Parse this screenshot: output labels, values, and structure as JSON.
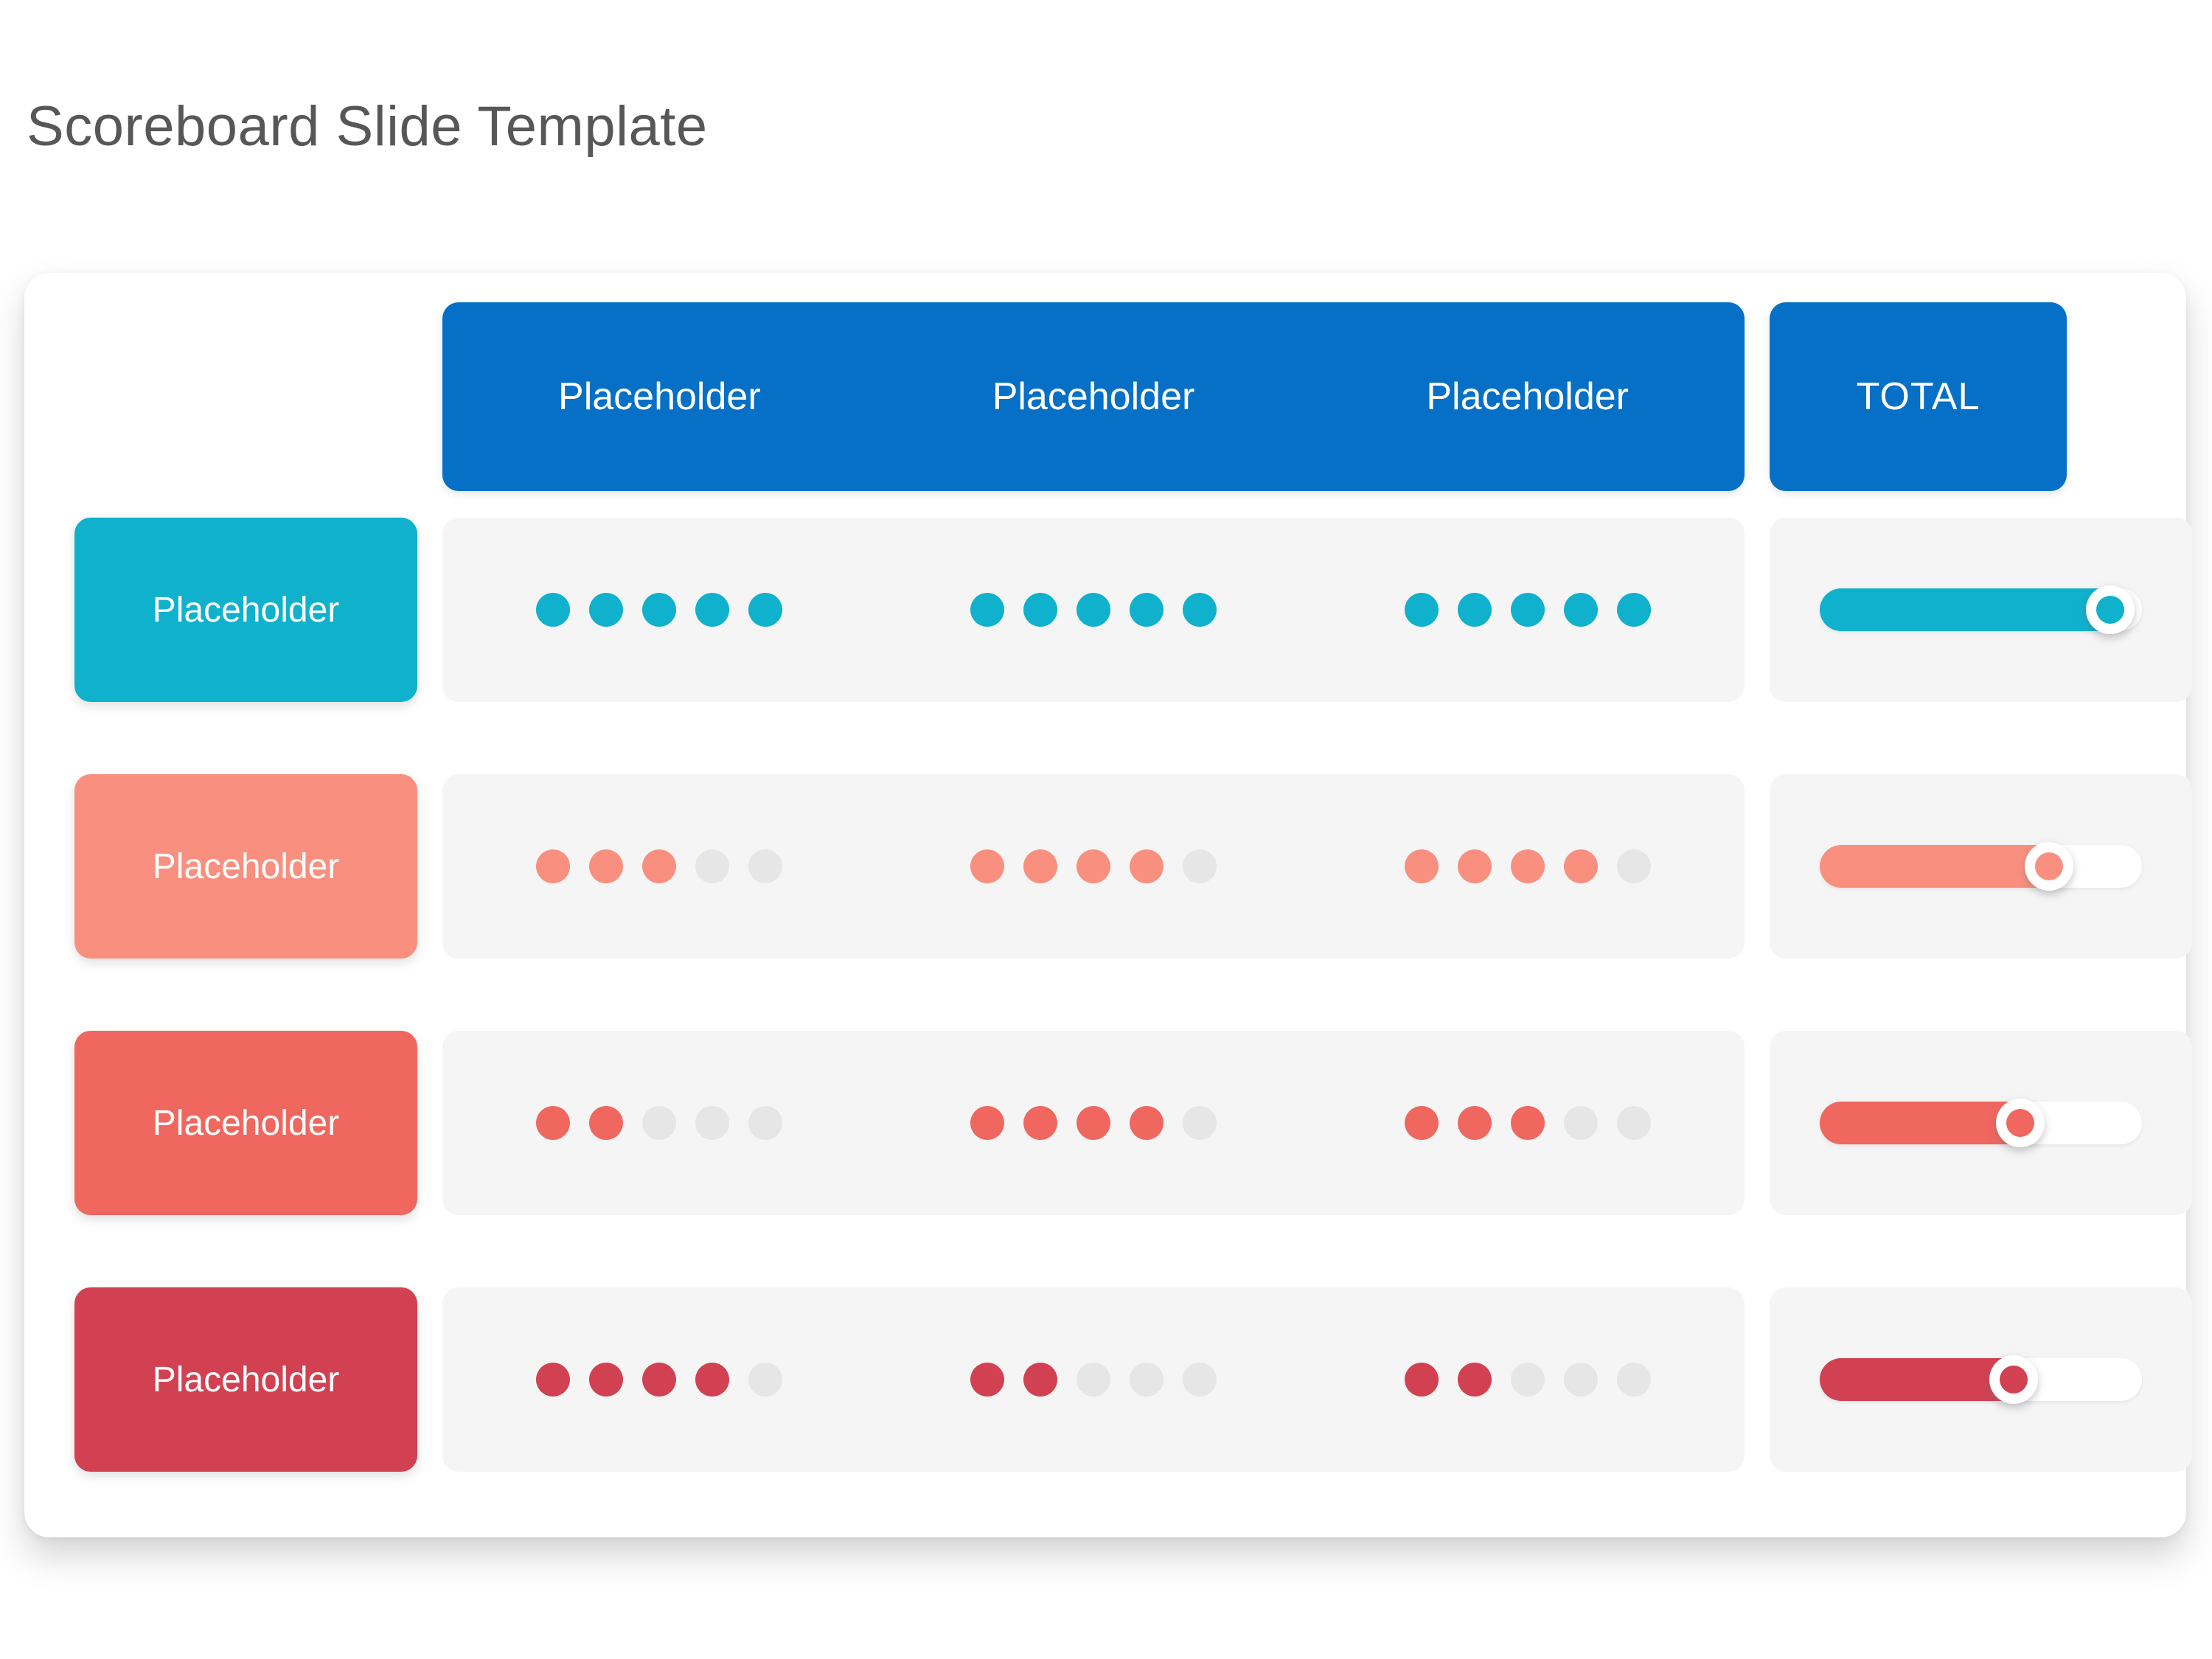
{
  "page": {
    "title": "Scoreboard Slide Template",
    "title_color": "#575757",
    "background": "#ffffff"
  },
  "theme": {
    "header_blue": "#0670c6",
    "panel_gray": "#f5f5f5",
    "empty_dot": "#e6e6e6",
    "card_white": "#ffffff"
  },
  "header": {
    "columns": [
      {
        "label": "Placeholder"
      },
      {
        "label": "Placeholder"
      },
      {
        "label": "Placeholder"
      }
    ],
    "total_label": "TOTAL"
  },
  "rows": [
    {
      "label": "Placeholder",
      "color": "#0fb1cd",
      "scores": [
        5,
        5,
        5
      ],
      "max": 5,
      "total_percent": 93
    },
    {
      "label": "Placeholder",
      "color": "#f9907f",
      "scores": [
        3,
        4,
        4
      ],
      "max": 5,
      "total_percent": 74
    },
    {
      "label": "Placeholder",
      "color": "#f0675f",
      "scores": [
        2,
        4,
        3
      ],
      "max": 5,
      "total_percent": 65
    },
    {
      "label": "Placeholder",
      "color": "#d24152",
      "scores": [
        4,
        2,
        2
      ],
      "max": 5,
      "total_percent": 63
    }
  ],
  "chart_data": {
    "type": "table",
    "title": "Scoreboard Slide Template",
    "columns": [
      "Placeholder",
      "Placeholder",
      "Placeholder",
      "TOTAL"
    ],
    "row_labels": [
      "Placeholder",
      "Placeholder",
      "Placeholder",
      "Placeholder"
    ],
    "rating_scale_max": 5,
    "series": [
      {
        "name": "Placeholder",
        "values": [
          5,
          5,
          5
        ],
        "total_percent": 93,
        "color": "#0fb1cd"
      },
      {
        "name": "Placeholder",
        "values": [
          3,
          4,
          4
        ],
        "total_percent": 74,
        "color": "#f9907f"
      },
      {
        "name": "Placeholder",
        "values": [
          2,
          4,
          3
        ],
        "total_percent": 65,
        "color": "#f0675f"
      },
      {
        "name": "Placeholder",
        "values": [
          4,
          2,
          2
        ],
        "total_percent": 63,
        "color": "#d24152"
      }
    ],
    "ylabel": "",
    "xlabel": "",
    "legend": "none",
    "grid": false
  }
}
